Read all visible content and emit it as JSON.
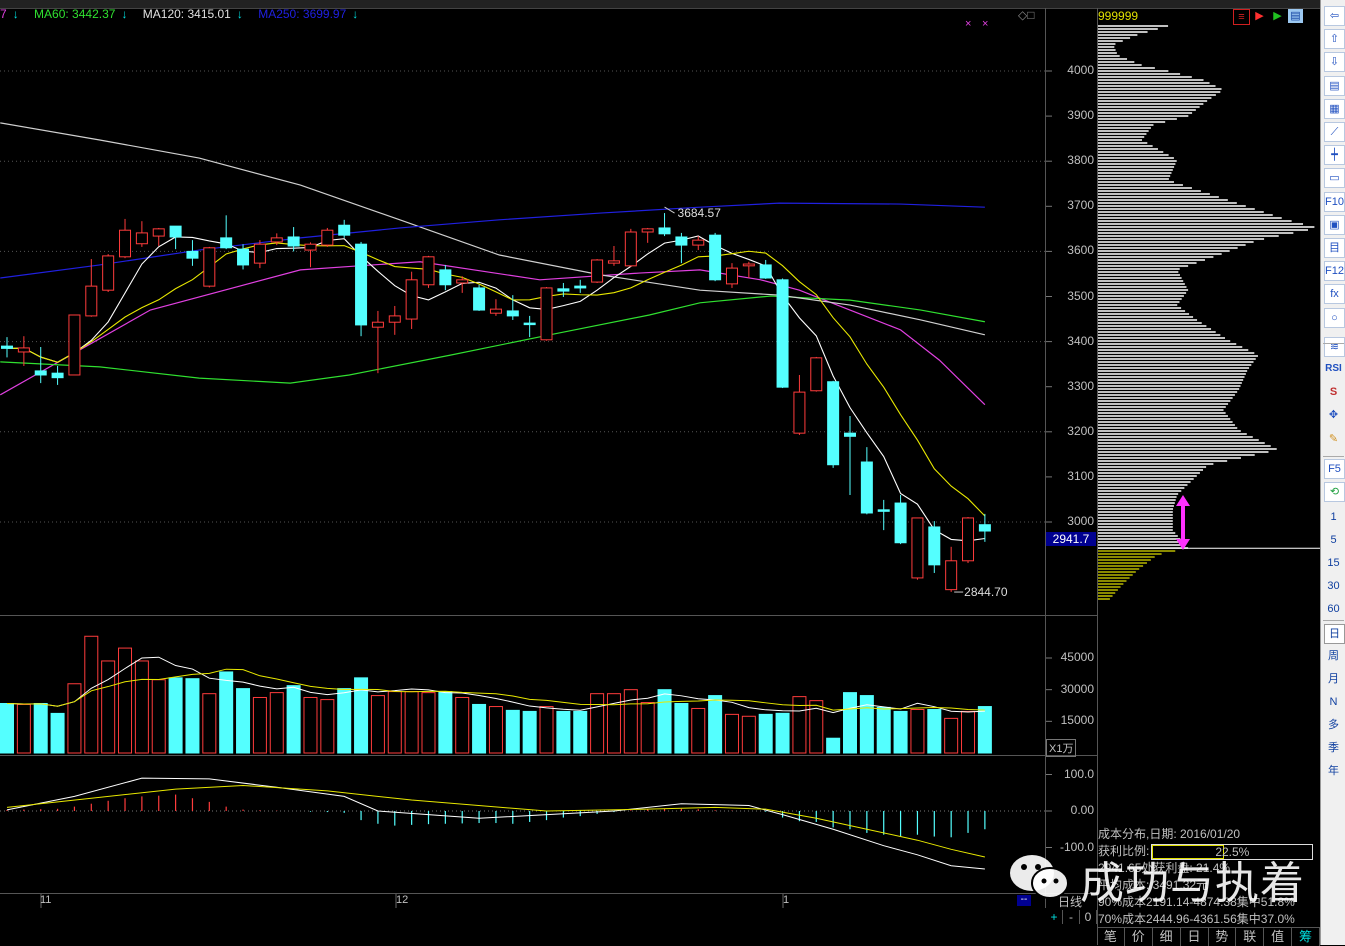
{
  "legend": {
    "ma_prev": {
      "text": "7",
      "color": "#e040e0"
    },
    "ma60": {
      "text": "MA60: 3442.37",
      "color": "#30e030"
    },
    "ma120": {
      "text": "MA120: 3415.01",
      "color": "#e0e0e0"
    },
    "ma250": {
      "text": "MA250: 3699.97",
      "color": "#2020e0"
    },
    "arrow": "↓"
  },
  "stock_code": "999999",
  "price_axis": {
    "ticks": [
      "4000",
      "3900",
      "3800",
      "3700",
      "3600",
      "3500",
      "3400",
      "3300",
      "3200",
      "3100",
      "3000"
    ],
    "current_price": "2941.7"
  },
  "volume_axis": {
    "ticks": [
      "45000",
      "30000",
      "15000"
    ],
    "unit": "X1万"
  },
  "macd_axis": {
    "ticks": [
      "100.0",
      "0.00",
      "-100.0"
    ]
  },
  "x_axis": {
    "labels": [
      "11",
      "12",
      "1"
    ]
  },
  "period_label": "日线",
  "zoom_controls": [
    "+",
    "-",
    "0"
  ],
  "dash_button": "--",
  "annotations": {
    "high": "3684.57",
    "low": "2844.70"
  },
  "chart_data": {
    "type": "candlestick",
    "title": "999999 日线",
    "candles_ohlc_note": "each candle = [open, close, high, low]",
    "candles": [
      [
        3390,
        3385,
        3410,
        3365
      ],
      [
        3377,
        3386,
        3412,
        3346
      ],
      [
        3335,
        3326,
        3388,
        3308
      ],
      [
        3330,
        3320,
        3346,
        3304
      ],
      [
        3326,
        3459,
        3459,
        3326
      ],
      [
        3457,
        3523,
        3583,
        3455
      ],
      [
        3514,
        3590,
        3594,
        3510
      ],
      [
        3588,
        3647,
        3672,
        3585
      ],
      [
        3617,
        3641,
        3667,
        3610
      ],
      [
        3634,
        3650,
        3652,
        3612
      ],
      [
        3656,
        3632,
        3656,
        3605
      ],
      [
        3600,
        3585,
        3625,
        3568
      ],
      [
        3523,
        3608,
        3610,
        3520
      ],
      [
        3630,
        3608,
        3680,
        3605
      ],
      [
        3605,
        3570,
        3616,
        3560
      ],
      [
        3574,
        3616,
        3625,
        3563
      ],
      [
        3621,
        3630,
        3640,
        3614
      ],
      [
        3632,
        3612,
        3654,
        3600
      ],
      [
        3603,
        3616,
        3620,
        3565
      ],
      [
        3614,
        3647,
        3652,
        3610
      ],
      [
        3658,
        3636,
        3670,
        3630
      ],
      [
        3616,
        3437,
        3621,
        3412
      ],
      [
        3432,
        3443,
        3468,
        3330
      ],
      [
        3443,
        3457,
        3479,
        3415
      ],
      [
        3450,
        3537,
        3555,
        3428
      ],
      [
        3526,
        3588,
        3590,
        3519
      ],
      [
        3559,
        3526,
        3570,
        3514
      ],
      [
        3530,
        3537,
        3545,
        3508
      ],
      [
        3519,
        3470,
        3526,
        3468
      ],
      [
        3463,
        3472,
        3494,
        3457
      ],
      [
        3468,
        3457,
        3503,
        3448
      ],
      [
        3441,
        3439,
        3457,
        3410
      ],
      [
        3404,
        3519,
        3521,
        3402
      ],
      [
        3517,
        3512,
        3530,
        3499
      ],
      [
        3523,
        3519,
        3537,
        3508
      ],
      [
        3532,
        3581,
        3583,
        3530
      ],
      [
        3574,
        3579,
        3612,
        3568
      ],
      [
        3568,
        3643,
        3650,
        3566
      ],
      [
        3643,
        3650,
        3652,
        3619
      ],
      [
        3652,
        3639,
        3685,
        3634
      ],
      [
        3632,
        3614,
        3641,
        3574
      ],
      [
        3614,
        3625,
        3634,
        3603
      ],
      [
        3636,
        3537,
        3641,
        3534
      ],
      [
        3528,
        3563,
        3574,
        3519
      ],
      [
        3568,
        3572,
        3577,
        3541
      ],
      [
        3570,
        3541,
        3581,
        3539
      ],
      [
        3537,
        3299,
        3540,
        3297
      ],
      [
        3197,
        3288,
        3326,
        3193
      ],
      [
        3291,
        3364,
        3366,
        3289
      ],
      [
        3311,
        3127,
        3313,
        3120
      ],
      [
        3197,
        3190,
        3235,
        3060
      ],
      [
        3133,
        3020,
        3166,
        3017
      ],
      [
        3027,
        3025,
        3049,
        2982
      ],
      [
        3042,
        2954,
        3060,
        2951
      ],
      [
        2876,
        3009,
        3010,
        2872
      ],
      [
        2989,
        2905,
        3002,
        2887
      ],
      [
        2850,
        2914,
        2945,
        2845
      ],
      [
        2914,
        3009,
        3011,
        2909
      ],
      [
        2994,
        2980,
        3018,
        2956
      ]
    ],
    "ma_lines": [
      {
        "name": "MA20",
        "color": "#e040e0",
        "points": [
          [
            -0.4,
            3282
          ],
          [
            8.5,
            3470
          ],
          [
            17.4,
            3559
          ],
          [
            20.9,
            3568
          ],
          [
            24.5,
            3577
          ],
          [
            31.6,
            3537
          ],
          [
            37.5,
            3552
          ],
          [
            41.1,
            3559
          ],
          [
            44.7,
            3537
          ],
          [
            47,
            3514
          ],
          [
            50,
            3470
          ],
          [
            53,
            3426
          ],
          [
            55.3,
            3359
          ],
          [
            58,
            3260
          ]
        ]
      },
      {
        "name": "MA60",
        "color": "#30e030",
        "points": [
          [
            -0.4,
            3355
          ],
          [
            5.5,
            3344
          ],
          [
            11.4,
            3319
          ],
          [
            16.8,
            3308
          ],
          [
            20.3,
            3326
          ],
          [
            26.3,
            3370
          ],
          [
            32.2,
            3415
          ],
          [
            38.1,
            3459
          ],
          [
            41.1,
            3486
          ],
          [
            45.3,
            3501
          ],
          [
            50,
            3492
          ],
          [
            54.2,
            3470
          ],
          [
            58,
            3444
          ]
        ]
      },
      {
        "name": "MA120",
        "color": "#d0d0d0",
        "points": [
          [
            -0.4,
            3885
          ],
          [
            5.5,
            3847
          ],
          [
            11.4,
            3807
          ],
          [
            17.4,
            3747
          ],
          [
            23.3,
            3670
          ],
          [
            29.2,
            3592
          ],
          [
            35.2,
            3548
          ],
          [
            41.1,
            3514
          ],
          [
            45.8,
            3503
          ],
          [
            50,
            3481
          ],
          [
            54.2,
            3448
          ],
          [
            58,
            3415
          ]
        ]
      },
      {
        "name": "MA250",
        "color": "#2020e0",
        "points": [
          [
            -0.4,
            3541
          ],
          [
            5.5,
            3570
          ],
          [
            11.4,
            3603
          ],
          [
            17.4,
            3630
          ],
          [
            23.3,
            3652
          ],
          [
            29.2,
            3670
          ],
          [
            35.2,
            3685
          ],
          [
            41.1,
            3698
          ],
          [
            45.8,
            3707
          ],
          [
            53,
            3705
          ],
          [
            58,
            3698
          ]
        ]
      }
    ],
    "volume_wan": [
      2345,
      2300,
      2345,
      1876,
      3280,
      5530,
      4360,
      4970,
      4360,
      3470,
      3560,
      3520,
      2810,
      3840,
      3050,
      2630,
      2860,
      3190,
      2630,
      2530,
      3050,
      3560,
      2720,
      2910,
      2910,
      2860,
      2910,
      2630,
      2300,
      2200,
      2020,
      1970,
      2200,
      1970,
      1970,
      2810,
      2810,
      3000,
      2390,
      3000,
      2345,
      2110,
      2720,
      1830,
      1740,
      1830,
      1880,
      2670,
      2480,
      700,
      2860,
      2720,
      2160,
      1970,
      2060,
      2060,
      1640,
      1970,
      2200
    ],
    "macd": {
      "hist": [
        3,
        4,
        5,
        6,
        12,
        20,
        28,
        35,
        40,
        42,
        45,
        35,
        25,
        12,
        4,
        2,
        1,
        0,
        -2,
        -3,
        -5,
        -25,
        -35,
        -40,
        -38,
        -36,
        -35,
        -34,
        -33,
        -33,
        -35,
        -30,
        -25,
        -18,
        -14,
        -8,
        -3,
        2,
        5,
        7,
        6,
        5,
        2,
        1,
        0,
        -2,
        -18,
        -28,
        -30,
        -45,
        -50,
        -60,
        -65,
        -70,
        -65,
        -70,
        -72,
        -60,
        -50
      ],
      "dif": [
        [
          0,
          3
        ],
        [
          4,
          40
        ],
        [
          8,
          90
        ],
        [
          12,
          88
        ],
        [
          16,
          65
        ],
        [
          20,
          40
        ],
        [
          22,
          0
        ],
        [
          28,
          -20
        ],
        [
          36,
          0
        ],
        [
          40,
          20
        ],
        [
          44,
          15
        ],
        [
          46,
          -10
        ],
        [
          49,
          -50
        ],
        [
          52,
          -95
        ],
        [
          54,
          -120
        ],
        [
          56,
          -150
        ],
        [
          58,
          -159
        ]
      ],
      "dea": [
        [
          0,
          10
        ],
        [
          5,
          35
        ],
        [
          10,
          60
        ],
        [
          14,
          70
        ],
        [
          19,
          55
        ],
        [
          24,
          30
        ],
        [
          32,
          0
        ],
        [
          38,
          5
        ],
        [
          42,
          10
        ],
        [
          45,
          5
        ],
        [
          48,
          -20
        ],
        [
          51,
          -50
        ],
        [
          54,
          -80
        ],
        [
          56,
          -105
        ],
        [
          58,
          -126
        ]
      ]
    }
  },
  "chip_distribution": {
    "profile_note": "[price, relative chip volume]",
    "profile": [
      [
        4100,
        0.32
      ],
      [
        4080,
        0.18
      ],
      [
        4058,
        0.07
      ],
      [
        4035,
        0.09
      ],
      [
        4013,
        0.2
      ],
      [
        4000,
        0.32
      ],
      [
        3980,
        0.48
      ],
      [
        3958,
        0.57
      ],
      [
        3935,
        0.5
      ],
      [
        3900,
        0.41
      ],
      [
        3880,
        0.25
      ],
      [
        3847,
        0.2
      ],
      [
        3803,
        0.36
      ],
      [
        3758,
        0.32
      ],
      [
        3714,
        0.59
      ],
      [
        3670,
        0.86
      ],
      [
        3652,
        1.0
      ],
      [
        3625,
        0.73
      ],
      [
        3592,
        0.55
      ],
      [
        3559,
        0.36
      ],
      [
        3514,
        0.41
      ],
      [
        3481,
        0.36
      ],
      [
        3448,
        0.45
      ],
      [
        3404,
        0.59
      ],
      [
        3370,
        0.73
      ],
      [
        3337,
        0.68
      ],
      [
        3293,
        0.64
      ],
      [
        3248,
        0.57
      ],
      [
        3204,
        0.64
      ],
      [
        3160,
        0.82
      ],
      [
        3126,
        0.5
      ],
      [
        3093,
        0.43
      ],
      [
        3060,
        0.36
      ],
      [
        3027,
        0.34
      ],
      [
        2982,
        0.34
      ],
      [
        2942,
        0.41
      ],
      [
        2927,
        0.27
      ],
      [
        2893,
        0.18
      ],
      [
        2860,
        0.11
      ],
      [
        2827,
        0.05
      ]
    ],
    "profit_color": "#b8b800",
    "loss_color": "#ffffff",
    "current_price": 2941.7,
    "info": {
      "date_line": "成本分布,日期: 2016/01/20",
      "profit_ratio_label": "获利比例:",
      "profit_ratio": "22.5%",
      "profit_ratio_value": 0.225,
      "profit_at_price": "2941.65处获利盘: 21.4%",
      "avg_cost": "平均成本: 3491.32元",
      "cost90": "90%成本2191.14-4874.38集中51.8%",
      "cost70": "70%成本2444.96-4361.56集中37.0%"
    },
    "tabs": [
      "笔",
      "价",
      "细",
      "日",
      "势",
      "联",
      "值",
      "筹"
    ],
    "active_tab": "筹"
  },
  "watermark": "成功与执着",
  "sidebar": {
    "icons": [
      {
        "name": "back-arrow-icon",
        "glyph": "⇦"
      },
      {
        "name": "up-arrow-icon",
        "glyph": "⇧"
      },
      {
        "name": "down-arrow-icon",
        "glyph": "⇩"
      },
      {
        "name": "report-check-icon",
        "glyph": "▤"
      },
      {
        "name": "grid-table-icon",
        "glyph": "▦"
      },
      {
        "name": "line-chart-icon",
        "glyph": "⟋"
      },
      {
        "name": "candlestick-icon",
        "glyph": "┿"
      },
      {
        "name": "window-list-icon",
        "glyph": "▭"
      },
      {
        "name": "f10-icon",
        "glyph": "F10"
      },
      {
        "name": "tree-icon",
        "glyph": "▣"
      },
      {
        "name": "notebook-icon",
        "glyph": "目"
      },
      {
        "name": "f12-icon",
        "glyph": "F12"
      },
      {
        "name": "formula-icon",
        "glyph": "fx"
      },
      {
        "name": "circle-icon",
        "glyph": "○"
      },
      {
        "name": "wave-icon",
        "glyph": "≋"
      },
      {
        "name": "rsi-icon",
        "glyph": "RSI"
      },
      {
        "name": "s-indicator-icon",
        "glyph": "S"
      },
      {
        "name": "move-cross-icon",
        "glyph": "✥"
      },
      {
        "name": "pencil-icon",
        "glyph": "✎"
      },
      {
        "name": "f5-icon",
        "glyph": "F5"
      },
      {
        "name": "refresh-icon",
        "glyph": "⟲"
      }
    ],
    "periods": [
      "1",
      "5",
      "15",
      "30",
      "60",
      "日",
      "周",
      "月",
      "N",
      "多",
      "季",
      "年"
    ]
  }
}
